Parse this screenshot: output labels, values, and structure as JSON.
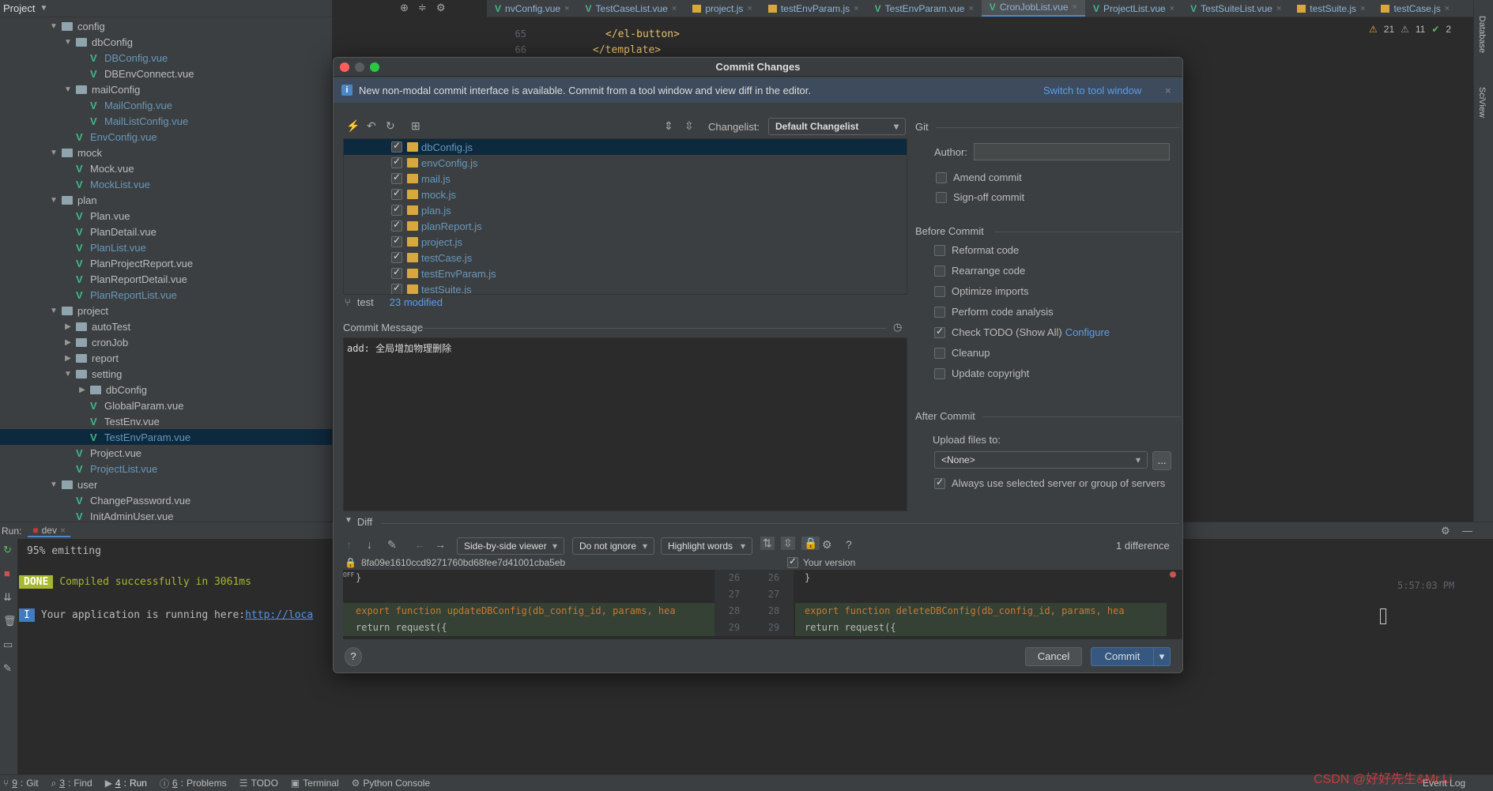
{
  "project_panel": {
    "title": "Project",
    "tree": [
      {
        "label": "config",
        "type": "folder",
        "depth": 1,
        "open": true
      },
      {
        "label": "dbConfig",
        "type": "folder",
        "depth": 2,
        "open": true
      },
      {
        "label": "DBConfig.vue",
        "type": "vue",
        "depth": 3,
        "blue": true
      },
      {
        "label": "DBEnvConnect.vue",
        "type": "vue",
        "depth": 3
      },
      {
        "label": "mailConfig",
        "type": "folder",
        "depth": 2,
        "open": true
      },
      {
        "label": "MailConfig.vue",
        "type": "vue",
        "depth": 3,
        "blue": true
      },
      {
        "label": "MailListConfig.vue",
        "type": "vue",
        "depth": 3,
        "blue": true
      },
      {
        "label": "EnvConfig.vue",
        "type": "vue",
        "depth": 2,
        "blue": true
      },
      {
        "label": "mock",
        "type": "folder",
        "depth": 1,
        "open": true
      },
      {
        "label": "Mock.vue",
        "type": "vue",
        "depth": 2
      },
      {
        "label": "MockList.vue",
        "type": "vue",
        "depth": 2,
        "blue": true
      },
      {
        "label": "plan",
        "type": "folder",
        "depth": 1,
        "open": true
      },
      {
        "label": "Plan.vue",
        "type": "vue",
        "depth": 2
      },
      {
        "label": "PlanDetail.vue",
        "type": "vue",
        "depth": 2
      },
      {
        "label": "PlanList.vue",
        "type": "vue",
        "depth": 2,
        "blue": true
      },
      {
        "label": "PlanProjectReport.vue",
        "type": "vue",
        "depth": 2
      },
      {
        "label": "PlanReportDetail.vue",
        "type": "vue",
        "depth": 2
      },
      {
        "label": "PlanReportList.vue",
        "type": "vue",
        "depth": 2,
        "blue": true
      },
      {
        "label": "project",
        "type": "folder",
        "depth": 1,
        "open": true
      },
      {
        "label": "autoTest",
        "type": "folder",
        "depth": 2,
        "open": false
      },
      {
        "label": "cronJob",
        "type": "folder",
        "depth": 2,
        "open": false
      },
      {
        "label": "report",
        "type": "folder",
        "depth": 2,
        "open": false
      },
      {
        "label": "setting",
        "type": "folder",
        "depth": 2,
        "open": true
      },
      {
        "label": "dbConfig",
        "type": "folder",
        "depth": 3,
        "open": false
      },
      {
        "label": "GlobalParam.vue",
        "type": "vue",
        "depth": 3
      },
      {
        "label": "TestEnv.vue",
        "type": "vue",
        "depth": 3
      },
      {
        "label": "TestEnvParam.vue",
        "type": "vue",
        "depth": 3,
        "blue": true,
        "selected": true
      },
      {
        "label": "Project.vue",
        "type": "vue",
        "depth": 2
      },
      {
        "label": "ProjectList.vue",
        "type": "vue",
        "depth": 2,
        "blue": true
      },
      {
        "label": "user",
        "type": "folder",
        "depth": 1,
        "open": true
      },
      {
        "label": "ChangePassword.vue",
        "type": "vue",
        "depth": 2
      },
      {
        "label": "InitAdminUser.vue",
        "type": "vue",
        "depth": 2
      }
    ]
  },
  "editor_tabs": [
    {
      "label": "nvConfig.vue",
      "icon": "vue"
    },
    {
      "label": "TestCaseList.vue",
      "icon": "vue"
    },
    {
      "label": "project.js",
      "icon": "js"
    },
    {
      "label": "testEnvParam.js",
      "icon": "js"
    },
    {
      "label": "TestEnvParam.vue",
      "icon": "vue"
    },
    {
      "label": "CronJobList.vue",
      "icon": "vue",
      "active": true
    },
    {
      "label": "ProjectList.vue",
      "icon": "vue"
    },
    {
      "label": "TestSuiteList.vue",
      "icon": "vue"
    },
    {
      "label": "testSuite.js",
      "icon": "js"
    },
    {
      "label": "testCase.js",
      "icon": "js"
    }
  ],
  "editor": {
    "lines": [
      {
        "num": "65",
        "code": "</el-button>"
      },
      {
        "num": "66",
        "code": "</template>"
      }
    ],
    "inspections": {
      "warnings": "21",
      "weak": "11",
      "ok": "2"
    }
  },
  "right_strip": {
    "items": [
      "Database",
      "SciView"
    ]
  },
  "run_panel": {
    "label": "Run:",
    "config": "dev",
    "lines": [
      {
        "text": "95% emitting"
      },
      {
        "badge": "DONE",
        "text": "Compiled successfully in 3061ms"
      },
      {
        "badge": "I",
        "text": "Your application is running here: ",
        "link": "http://loca"
      }
    ],
    "timestamp": "5:57:03 PM"
  },
  "status_bar": {
    "items": [
      {
        "key": "9",
        "label": "Git"
      },
      {
        "key": "3",
        "label": "Find"
      },
      {
        "key": "4",
        "label": "Run"
      },
      {
        "key": "6",
        "label": "Problems"
      },
      {
        "key": "",
        "label": "TODO"
      },
      {
        "key": "",
        "label": "Terminal"
      },
      {
        "key": "",
        "label": "Python Console"
      }
    ],
    "event_log": "Event Log",
    "watermark": "CSDN @好好先生&Mr.Li"
  },
  "dialog": {
    "title": "Commit Changes",
    "banner_text": "New non-modal commit interface is available. Commit from a tool window and view diff in the editor.",
    "banner_link": "Switch to tool window",
    "changelist_label": "Changelist:",
    "changelist_value": "Default Changelist",
    "files": [
      {
        "name": "dbConfig.js",
        "checked": true,
        "selected": true
      },
      {
        "name": "envConfig.js",
        "checked": true
      },
      {
        "name": "mail.js",
        "checked": true
      },
      {
        "name": "mock.js",
        "checked": true
      },
      {
        "name": "plan.js",
        "checked": true
      },
      {
        "name": "planReport.js",
        "checked": true
      },
      {
        "name": "project.js",
        "checked": true
      },
      {
        "name": "testCase.js",
        "checked": true
      },
      {
        "name": "testEnvParam.js",
        "checked": true
      },
      {
        "name": "testSuite.js",
        "checked": true
      }
    ],
    "branch": "test",
    "modified": "23 modified",
    "commit_message_label": "Commit Message",
    "commit_message": "add: 全局增加物理删除",
    "git": {
      "heading": "Git",
      "author_label": "Author:",
      "author_value": "",
      "amend": {
        "label": "Amend commit",
        "checked": false
      },
      "signoff": {
        "label": "Sign-off commit",
        "checked": false
      }
    },
    "before_commit": {
      "heading": "Before Commit",
      "options": [
        {
          "label": "Reformat code",
          "checked": false
        },
        {
          "label": "Rearrange code",
          "checked": false
        },
        {
          "label": "Optimize imports",
          "checked": false
        },
        {
          "label": "Perform code analysis",
          "checked": false
        },
        {
          "label": "Check TODO (Show All)",
          "checked": true,
          "link": "Configure"
        },
        {
          "label": "Cleanup",
          "checked": false
        },
        {
          "label": "Update copyright",
          "checked": false
        }
      ]
    },
    "after_commit": {
      "heading": "After Commit",
      "upload_label": "Upload files to:",
      "upload_value": "<None>",
      "browse": "...",
      "always_use": {
        "label": "Always use selected server or group of servers",
        "checked": true
      }
    },
    "diff": {
      "heading": "Diff",
      "viewer": "Side-by-side viewer",
      "ignore": "Do not ignore",
      "highlight": "Highlight words",
      "help": "?",
      "differences": "1 difference",
      "revision": "8fa09e1610ccd9271760bd68fee7d41001cba5eb",
      "your_version": "Your version",
      "left_lines": [
        {
          "num": "26",
          "code": "}",
          "prefix": "OFF"
        },
        {
          "num": "27",
          "code": ""
        },
        {
          "num": "28",
          "code": "export function updateDBConfig(db_config_id, params, hea"
        },
        {
          "num": "29",
          "code": "  return request({"
        }
      ],
      "right_lines": [
        {
          "num": "26",
          "code": "}"
        },
        {
          "num": "27",
          "code": ""
        },
        {
          "num": "28",
          "code": "export function deleteDBConfig(db_config_id, params, hea"
        },
        {
          "num": "29",
          "code": "  return request({"
        }
      ]
    },
    "buttons": {
      "help": "?",
      "cancel": "Cancel",
      "commit": "Commit"
    }
  }
}
